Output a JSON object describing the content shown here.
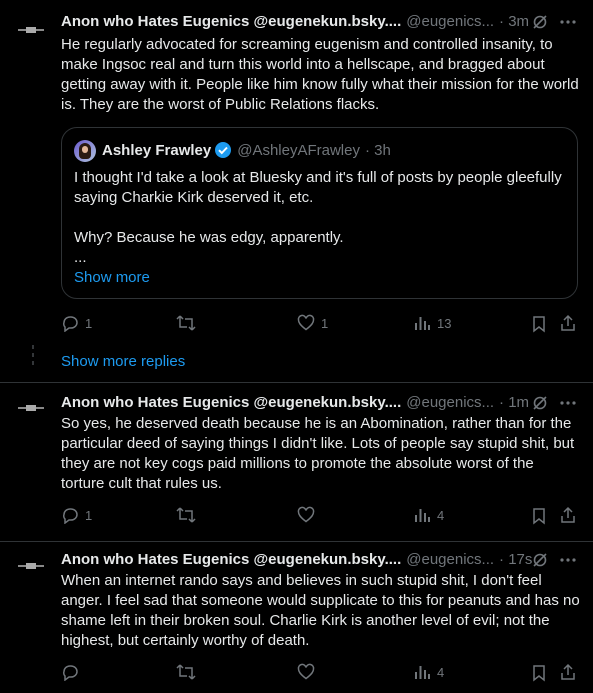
{
  "colors": {
    "background": "#000000",
    "text": "#e7e9ea",
    "muted": "#71767b",
    "accent": "#1d9bf0",
    "border": "#2f3336"
  },
  "posts": [
    {
      "author": "Anon who Hates Eugenics @eugenekun.bsky....",
      "handle": "@eugenics...",
      "time": "· 3m",
      "text": "He regularly advocated for screaming eugenism and controlled insanity, to make Ingsoc real and turn this world into a hellscape, and bragged about getting away with it. People like him know fully what their mission for the world is. They are the worst of Public Relations flacks.",
      "quote": {
        "author": "Ashley Frawley",
        "handle": "@AshleyAFrawley",
        "time": "· 3h",
        "lines": [
          "I thought I'd take a look at Bluesky and it's full of posts by people gleefully saying Charkie Kirk deserved it, etc.",
          "Why? Because he was edgy, apparently.",
          "..."
        ],
        "show_more": "Show more"
      },
      "replies": "1",
      "reposts": "",
      "likes": "1",
      "views": "13"
    },
    {
      "author": "Anon who Hates Eugenics @eugenekun.bsky....",
      "handle": "@eugenics...",
      "time": "· 1m",
      "text": "So yes, he deserved death because he is an Abomination, rather than for the particular deed of saying things I didn't like. Lots of people say stupid shit, but they are not key cogs paid millions to promote the absolute worst of the torture cult that rules us.",
      "replies": "1",
      "reposts": "",
      "likes": "",
      "views": "4"
    },
    {
      "author": "Anon who Hates Eugenics @eugenekun.bsky....",
      "handle": "@eugenics...",
      "time": "· 17s",
      "text": "When an internet rando says and believes in such stupid shit, I don't feel anger. I feel sad that someone would supplicate to this for peanuts and has no shame left in their broken soul. Charlie Kirk is another level of evil; not the highest, but certainly worthy of death.",
      "replies": "",
      "reposts": "",
      "likes": "",
      "views": "4"
    }
  ],
  "show_more_replies": "Show more replies"
}
